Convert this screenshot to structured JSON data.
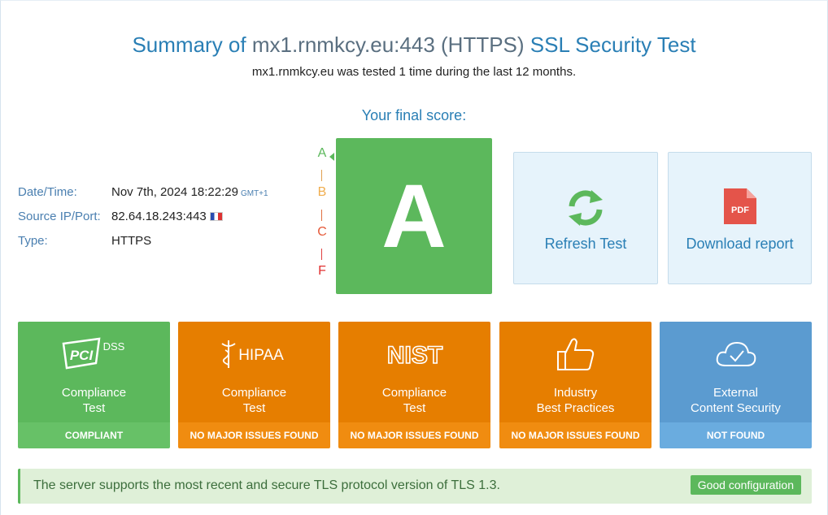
{
  "header": {
    "title_prefix": "Summary of",
    "title_domain": "mx1.rnmkcy.eu:443 (HTTPS)",
    "title_suffix": "SSL Security Test",
    "subtitle": "mx1.rnmkcy.eu was tested 1 time during the last 12 months.",
    "score_label": "Your final score:"
  },
  "info": {
    "datetime_label": "Date/Time:",
    "datetime_value": "Nov 7th, 2024 18:22:29",
    "timezone": "GMT+1",
    "source_label": "Source IP/Port:",
    "source_value": "82.64.18.243:443",
    "type_label": "Type:",
    "type_value": "HTTPS"
  },
  "grade": {
    "value": "A",
    "scale": [
      "A",
      "B",
      "C",
      "F"
    ],
    "color": "#5cb85c"
  },
  "actions": {
    "refresh_label": "Refresh Test",
    "download_label": "Download report",
    "pdf_text": "PDF"
  },
  "cards": [
    {
      "logo_text": "PCI",
      "logo_sub": "DSS",
      "line1": "Compliance",
      "line2": "Test",
      "status": "COMPLIANT",
      "color": "#5cb85c"
    },
    {
      "logo_text": "HIPAA",
      "line1": "Compliance",
      "line2": "Test",
      "status": "NO MAJOR ISSUES FOUND",
      "color": "#e67e00"
    },
    {
      "logo_text": "NIST",
      "line1": "Compliance",
      "line2": "Test",
      "status": "NO MAJOR ISSUES FOUND",
      "color": "#e67e00"
    },
    {
      "logo_text": "",
      "line1": "Industry",
      "line2": "Best Practices",
      "status": "NO MAJOR ISSUES FOUND",
      "color": "#e67e00"
    },
    {
      "logo_text": "",
      "line1": "External",
      "line2": "Content Security",
      "status": "NOT FOUND",
      "color": "#5b9bd0"
    }
  ],
  "notice": {
    "message": "The server supports the most recent and secure TLS protocol version of TLS 1.3.",
    "badge": "Good configuration"
  }
}
